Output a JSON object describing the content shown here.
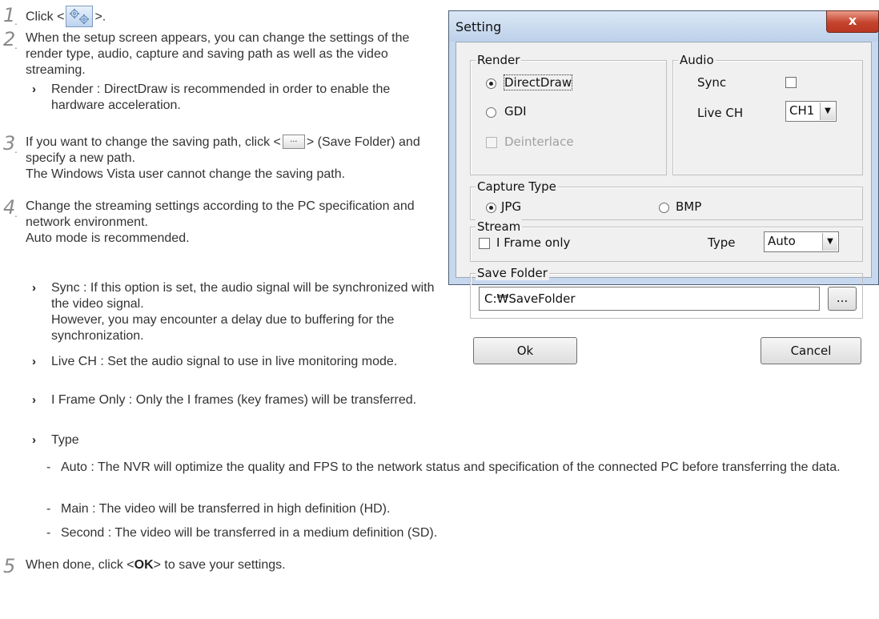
{
  "steps": [
    {
      "num": "1",
      "text_before": "Click <",
      "icon": "settings-gear-icon",
      "text_after": ">."
    },
    {
      "num": "2",
      "text": "When the setup screen appears, you can change the settings of the render type, audio, capture and saving path as well as the video streaming.",
      "bullets": [
        {
          "text": "Render : DirectDraw is recommended in order to enable the hardware acceleration."
        }
      ]
    },
    {
      "num": "3",
      "text_before": "If you want to change the saving path, click <",
      "button_label": "...",
      "text_after": "> (Save Folder) and specify a new path.",
      "line2": "The Windows Vista user cannot change the saving path."
    },
    {
      "num": "4",
      "text": "Change the streaming settings according to the PC specification and network environment.",
      "line2": "Auto mode is recommended.",
      "bullets": [
        {
          "text": "Sync : If this option is set, the audio signal will be synchronized with the video signal.",
          "line2": "However, you may encounter a delay due to buffering for the synchronization."
        },
        {
          "text": "Live CH : Set the audio signal to use in live monitoring mode."
        },
        {
          "text": "I Frame Only : Only the I frames (key frames) will be transferred."
        },
        {
          "text": "Type"
        }
      ],
      "type_items": [
        {
          "dash": "-",
          "text": "Auto : The NVR will optimize the quality and FPS to the network status and specification of the connected PC before transferring the data."
        },
        {
          "dash": "-",
          "text": "Main : The video will be transferred in high definition (HD)."
        },
        {
          "dash": "-",
          "text": "Second : The video will be transferred in a medium definition (SD)."
        }
      ]
    },
    {
      "num": "5",
      "text_before": "When done, click <",
      "bold": "OK",
      "text_after": "> to save your settings."
    }
  ],
  "dialog": {
    "title": "Setting",
    "close": "x",
    "render": {
      "legend": "Render",
      "directdraw": "DirectDraw",
      "gdi": "GDI",
      "deinterlace": "Deinterlace"
    },
    "audio": {
      "legend": "Audio",
      "sync": "Sync",
      "live_ch": "Live CH",
      "live_ch_value": "CH1"
    },
    "capture": {
      "legend": "Capture Type",
      "jpg": "JPG",
      "bmp": "BMP"
    },
    "stream": {
      "legend": "Stream",
      "iframe": "I Frame only",
      "type_label": "Type",
      "type_value": "Auto"
    },
    "save": {
      "legend": "Save Folder",
      "path": "C:₩SaveFolder",
      "browse": "..."
    },
    "ok": "Ok",
    "cancel": "Cancel"
  }
}
